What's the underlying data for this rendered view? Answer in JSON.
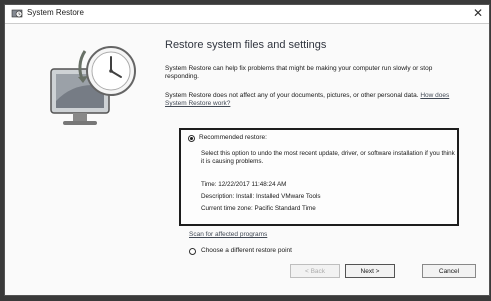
{
  "window": {
    "title": "System Restore",
    "close_glyph": "✕"
  },
  "content": {
    "heading": "Restore system files and settings",
    "intro": "System Restore can help fix problems that might be making your computer run slowly or stop responding.",
    "note": "System Restore does not affect any of your documents, pictures, or other personal data.",
    "note_link": "How does System Restore work?"
  },
  "recommended": {
    "label": "Recommended restore:",
    "selected": true,
    "description": "Select this option to undo the most recent update, driver, or software installation if you think it is causing problems.",
    "time": "Time: 12/22/2017 11:48:24 AM",
    "description_line": "Description: Install: Installed VMware Tools",
    "timezone": "Current time zone: Pacific Standard Time"
  },
  "scan_link": "Scan for affected programs",
  "different": {
    "label": "Choose a different restore point",
    "selected": false
  },
  "buttons": {
    "back": "< Back",
    "next": "Next >",
    "cancel": "Cancel"
  },
  "icons": {
    "title_icon": "system-restore-icon",
    "art": "clock-monitor-restore-icon"
  }
}
